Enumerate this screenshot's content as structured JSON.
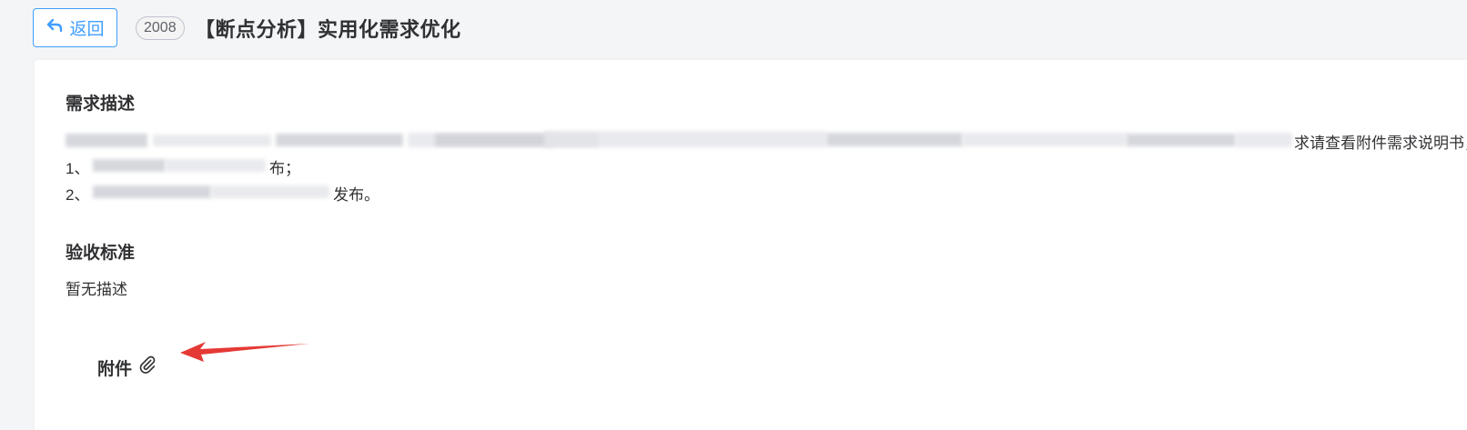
{
  "header": {
    "back_label": "返回",
    "id_badge": "2008",
    "title": "【断点分析】实用化需求优化"
  },
  "requirement": {
    "heading": "需求描述",
    "line1_tail": "求请查看附件需求说明书，要求",
    "line2_prefix": "1、",
    "line2_suffix": "布；",
    "line3_prefix": "2、",
    "line3_suffix": "发布。"
  },
  "acceptance": {
    "heading": "验收标准",
    "text": "暂无描述"
  },
  "attachment": {
    "label": "附件",
    "icon": "paperclip-icon"
  },
  "colors": {
    "accent": "#409eff",
    "arrow": "#e53935",
    "text": "#303133"
  }
}
